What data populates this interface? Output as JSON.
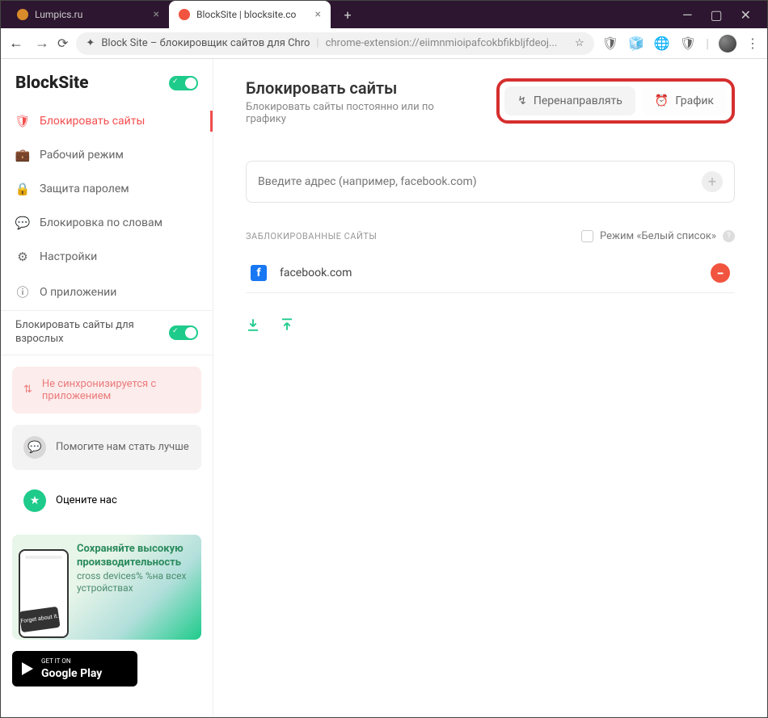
{
  "window": {
    "tabs": [
      {
        "title": "Lumpics.ru",
        "favicon_color": "#d88b2a"
      },
      {
        "title": "BlockSite | blocksite.co",
        "favicon_color": "#f1543f"
      }
    ]
  },
  "toolbar": {
    "site_name": "Block Site – блокировщик сайтов для Chro",
    "url_tail": "chrome-extension://eiimnmioipafcokbfikbljfdeoj...",
    "ext_glyphs": [
      "🛡",
      "🧊",
      "🌐",
      "🛡"
    ]
  },
  "sidebar": {
    "brand": "BlockSite",
    "items": [
      {
        "icon": "🛡",
        "label": "Блокировать сайты"
      },
      {
        "icon": "💼",
        "label": "Рабочий режим"
      },
      {
        "icon": "🔒",
        "label": "Защита паролем"
      },
      {
        "icon": "💬",
        "label": "Блокировка по словам"
      },
      {
        "icon": "⚙",
        "label": "Настройки"
      },
      {
        "icon": "ⓘ",
        "label": "О приложении"
      }
    ],
    "adult_label": "Блокировать сайты для взрослых",
    "sync_card": "Не синхронизируется с приложением",
    "help_card": "Помогите нам стать лучше",
    "rate_card": "Оцените нас",
    "promo": {
      "title": "Сохраняйте высокую производительность",
      "subtitle": "cross devices% %на всех устройствах",
      "bubble": "Forget about it."
    },
    "gplay": {
      "small": "GET IT ON",
      "big": "Google Play"
    }
  },
  "main": {
    "title": "Блокировать сайты",
    "subtitle": "Блокировать сайты постоянно или по графику",
    "redirect_btn": "Перенаправлять",
    "schedule_btn": "График",
    "placeholder": "Введите адрес (например, facebook.com)",
    "blocked_heading": "ЗАБЛОКИРОВАННЫЕ САЙТЫ",
    "whitelist_label": "Режим «Белый список»",
    "blocked": [
      {
        "icon_letter": "f",
        "domain": "facebook.com"
      }
    ]
  }
}
